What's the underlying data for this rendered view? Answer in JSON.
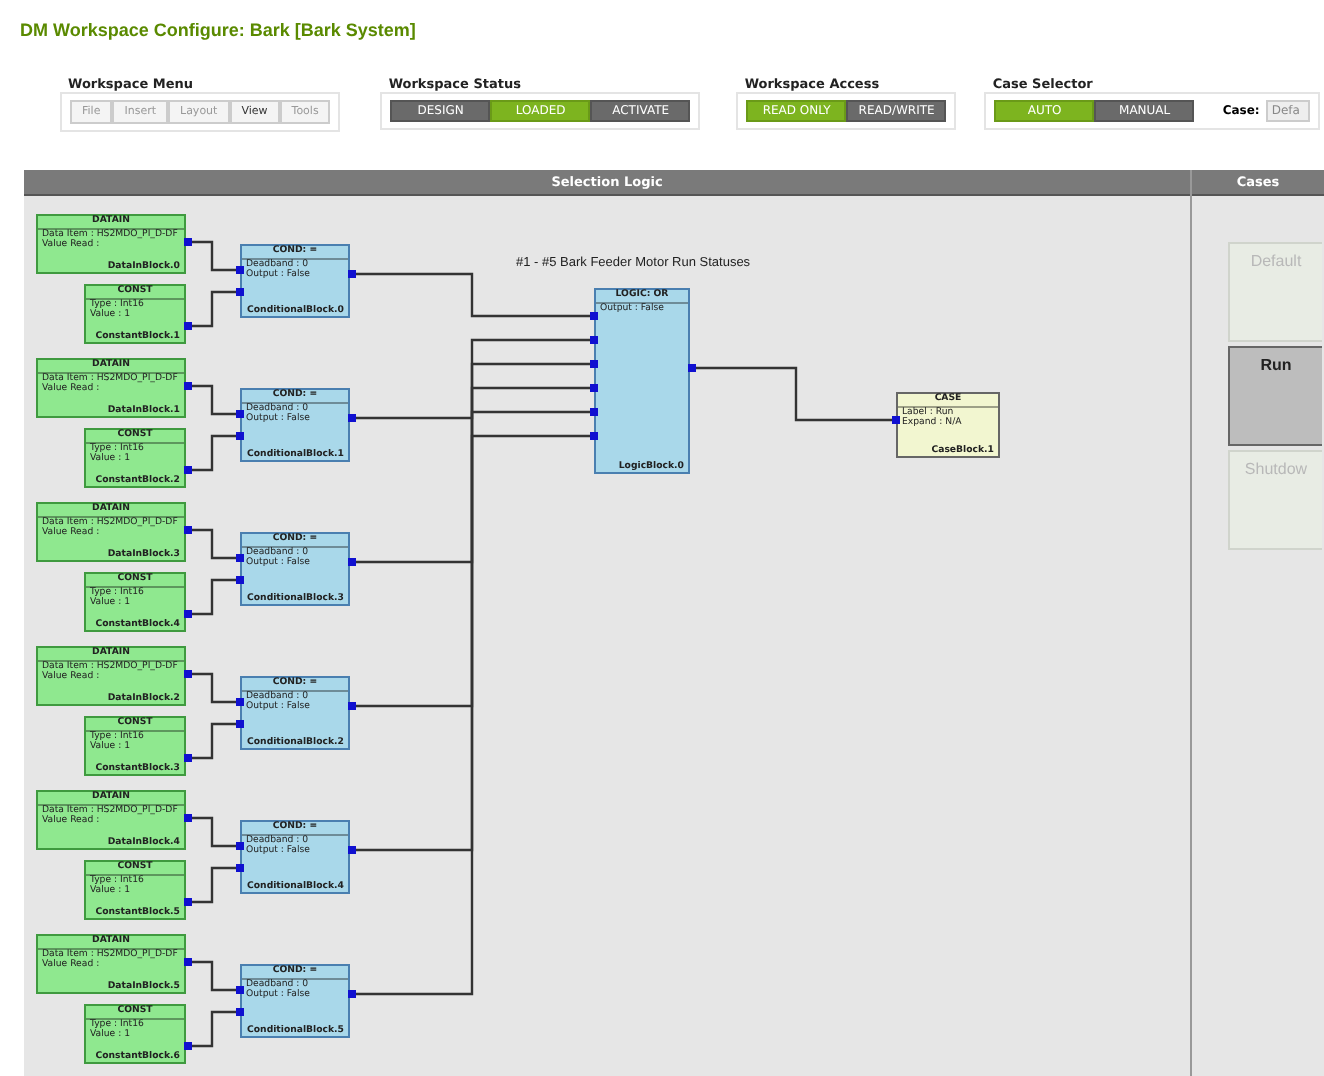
{
  "title": "DM Workspace Configure: Bark [Bark System]",
  "workspace_menu": {
    "label": "Workspace Menu",
    "items": [
      {
        "label": "File",
        "disabled": true
      },
      {
        "label": "Insert",
        "disabled": true
      },
      {
        "label": "Layout",
        "disabled": true
      },
      {
        "label": "View",
        "disabled": false
      },
      {
        "label": "Tools",
        "disabled": true
      }
    ]
  },
  "workspace_status": {
    "label": "Workspace Status",
    "options": [
      {
        "label": "DESIGN",
        "selected": false
      },
      {
        "label": "LOADED",
        "selected": true
      },
      {
        "label": "ACTIVATE",
        "selected": false
      }
    ]
  },
  "workspace_access": {
    "label": "Workspace Access",
    "options": [
      {
        "label": "READ ONLY",
        "selected": true
      },
      {
        "label": "READ/WRITE",
        "selected": false
      }
    ]
  },
  "case_selector": {
    "label": "Case Selector",
    "options": [
      {
        "label": "AUTO",
        "selected": true
      },
      {
        "label": "MANUAL",
        "selected": false
      }
    ],
    "case_label": "Case:",
    "case_value": "Defa"
  },
  "selection_logic": {
    "header": "Selection Logic",
    "caption": "#1 - #5 Bark Feeder Motor Run Statuses",
    "groups": [
      {
        "datain": {
          "title": "DATAIN",
          "lines": [
            "Data Item : HS2MDO_PI_D-DF",
            "Value Read :"
          ],
          "name": "DataInBlock.0"
        },
        "const": {
          "title": "CONST",
          "lines": [
            "Type : Int16",
            "Value : 1"
          ],
          "name": "ConstantBlock.1"
        },
        "cond": {
          "title": "COND: =",
          "lines": [
            "Deadband : 0",
            "Output : False"
          ],
          "name": "ConditionalBlock.0"
        }
      },
      {
        "datain": {
          "title": "DATAIN",
          "lines": [
            "Data Item : HS2MDO_PI_D-DF",
            "Value Read :"
          ],
          "name": "DataInBlock.1"
        },
        "const": {
          "title": "CONST",
          "lines": [
            "Type : Int16",
            "Value : 1"
          ],
          "name": "ConstantBlock.2"
        },
        "cond": {
          "title": "COND: =",
          "lines": [
            "Deadband : 0",
            "Output : False"
          ],
          "name": "ConditionalBlock.1"
        }
      },
      {
        "datain": {
          "title": "DATAIN",
          "lines": [
            "Data Item : HS2MDO_PI_D-DF",
            "Value Read :"
          ],
          "name": "DataInBlock.3"
        },
        "const": {
          "title": "CONST",
          "lines": [
            "Type : Int16",
            "Value : 1"
          ],
          "name": "ConstantBlock.4"
        },
        "cond": {
          "title": "COND: =",
          "lines": [
            "Deadband : 0",
            "Output : False"
          ],
          "name": "ConditionalBlock.3"
        }
      },
      {
        "datain": {
          "title": "DATAIN",
          "lines": [
            "Data Item : HS2MDO_PI_D-DF",
            "Value Read :"
          ],
          "name": "DataInBlock.2"
        },
        "const": {
          "title": "CONST",
          "lines": [
            "Type : Int16",
            "Value : 1"
          ],
          "name": "ConstantBlock.3"
        },
        "cond": {
          "title": "COND: =",
          "lines": [
            "Deadband : 0",
            "Output : False"
          ],
          "name": "ConditionalBlock.2"
        }
      },
      {
        "datain": {
          "title": "DATAIN",
          "lines": [
            "Data Item : HS2MDO_PI_D-DF",
            "Value Read :"
          ],
          "name": "DataInBlock.4"
        },
        "const": {
          "title": "CONST",
          "lines": [
            "Type : Int16",
            "Value : 1"
          ],
          "name": "ConstantBlock.5"
        },
        "cond": {
          "title": "COND: =",
          "lines": [
            "Deadband : 0",
            "Output : False"
          ],
          "name": "ConditionalBlock.4"
        }
      },
      {
        "datain": {
          "title": "DATAIN",
          "lines": [
            "Data Item : HS2MDO_PI_D-DF",
            "Value Read :"
          ],
          "name": "DataInBlock.5"
        },
        "const": {
          "title": "CONST",
          "lines": [
            "Type : Int16",
            "Value : 1"
          ],
          "name": "ConstantBlock.6"
        },
        "cond": {
          "title": "COND: =",
          "lines": [
            "Deadband : 0",
            "Output : False"
          ],
          "name": "ConditionalBlock.5"
        }
      }
    ],
    "logic": {
      "title": "LOGIC: OR",
      "lines": [
        "Output : False"
      ],
      "name": "LogicBlock.0"
    },
    "case": {
      "title": "CASE",
      "lines": [
        "Label : Run",
        "Expand : N/A"
      ],
      "name": "CaseBlock.1"
    }
  },
  "cases": {
    "header": "Cases",
    "items": [
      {
        "label": "Default",
        "selected": false
      },
      {
        "label": "Run",
        "selected": true
      },
      {
        "label": "Shutdow",
        "selected": false
      }
    ]
  }
}
